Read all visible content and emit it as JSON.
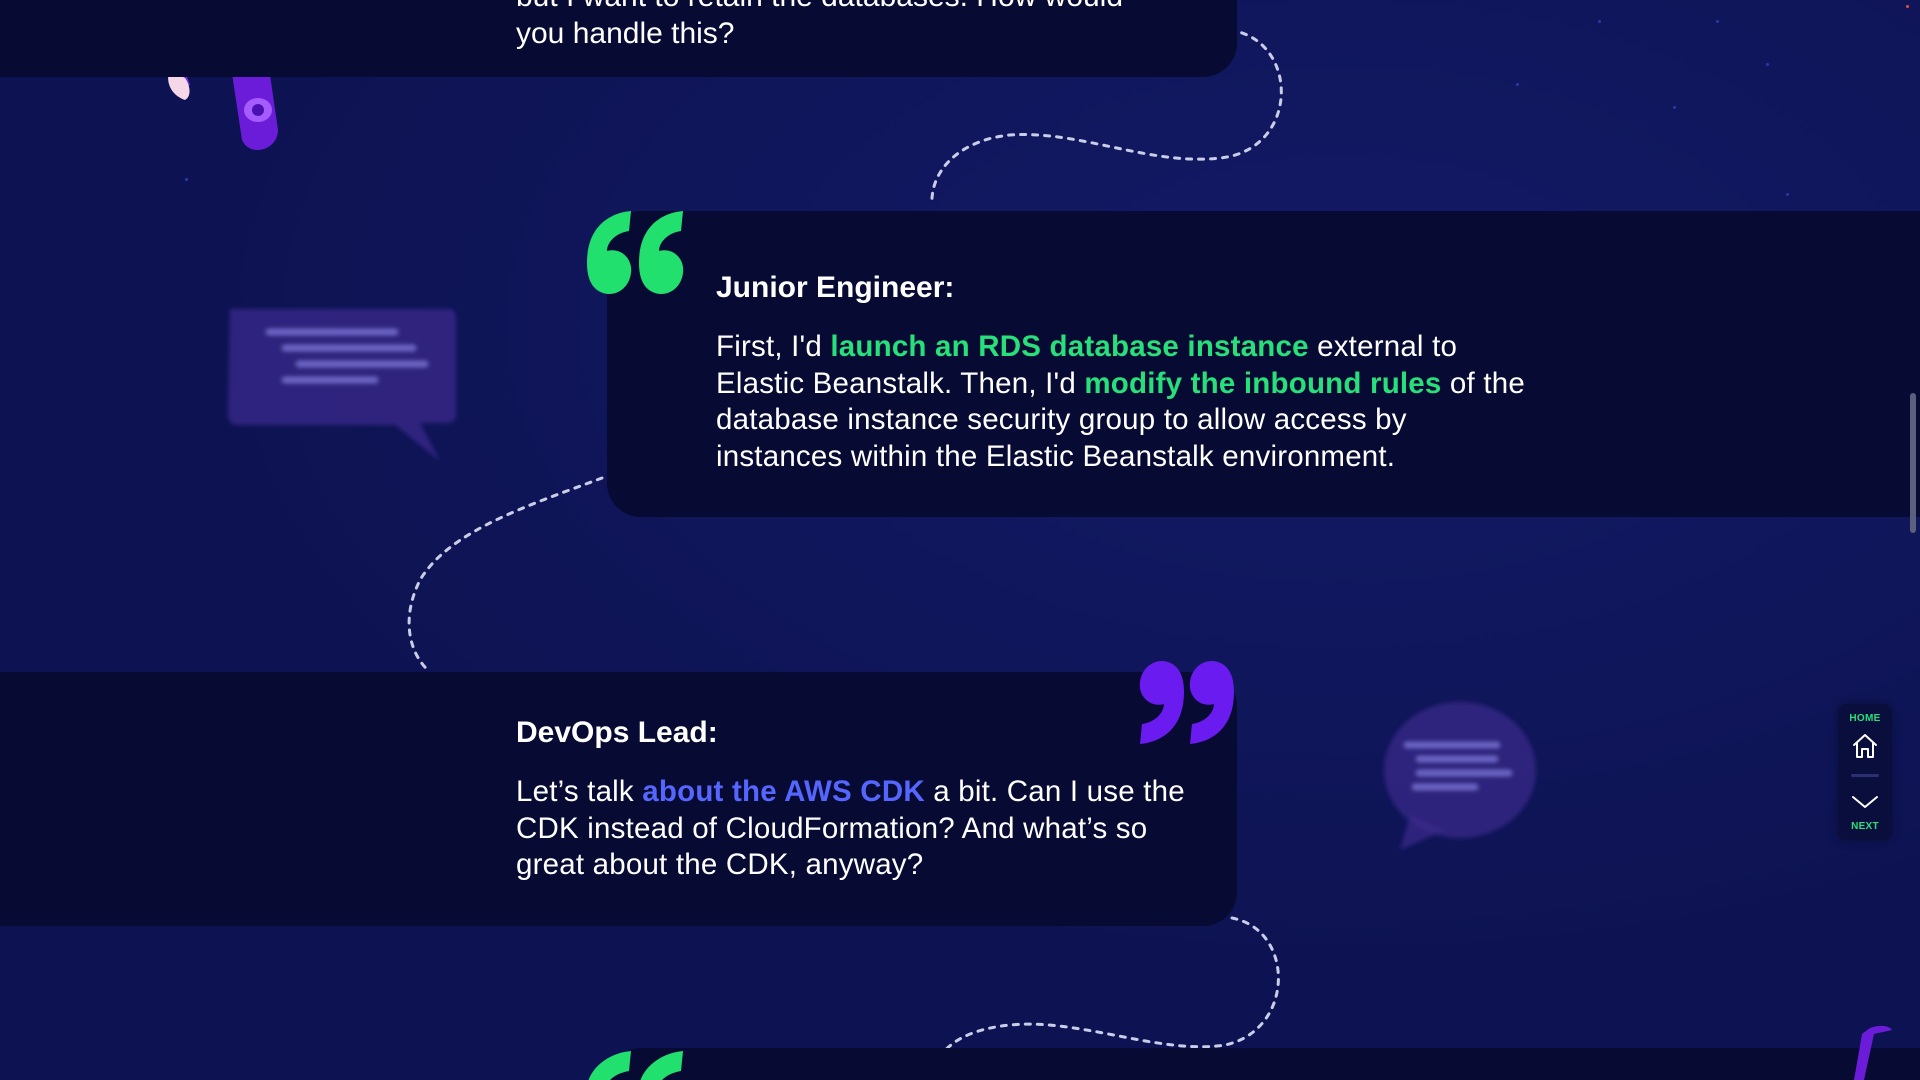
{
  "previous_card": {
    "line1": "but I want to retain the databases. How would",
    "line2": "you handle this?"
  },
  "junior": {
    "speaker": "Junior Engineer:",
    "t1": "First, I'd ",
    "h1": "launch an RDS database instance",
    "t2": " external to Elastic Beanstalk. Then, I'd ",
    "h2": "modify the inbound rules",
    "t3": " of the database instance security group to allow access by instances within the Elastic Beanstalk environment."
  },
  "devops": {
    "speaker": "DevOps Lead:",
    "t1": "Let’s talk ",
    "h1": "about the AWS CDK",
    "t2": " a bit. Can I use the CDK instead of CloudFormation? And what’s so great about the CDK, anyway?"
  },
  "nav": {
    "home_label": "HOME",
    "next_label": "NEXT",
    "home_icon": "home-icon",
    "next_icon": "chevron-down-icon"
  },
  "colors": {
    "background": "#0d1352",
    "card": "#070a33",
    "highlight_green": "#28e07a",
    "highlight_blue": "#5566ff",
    "quote_purple": "#6a1cf0"
  }
}
